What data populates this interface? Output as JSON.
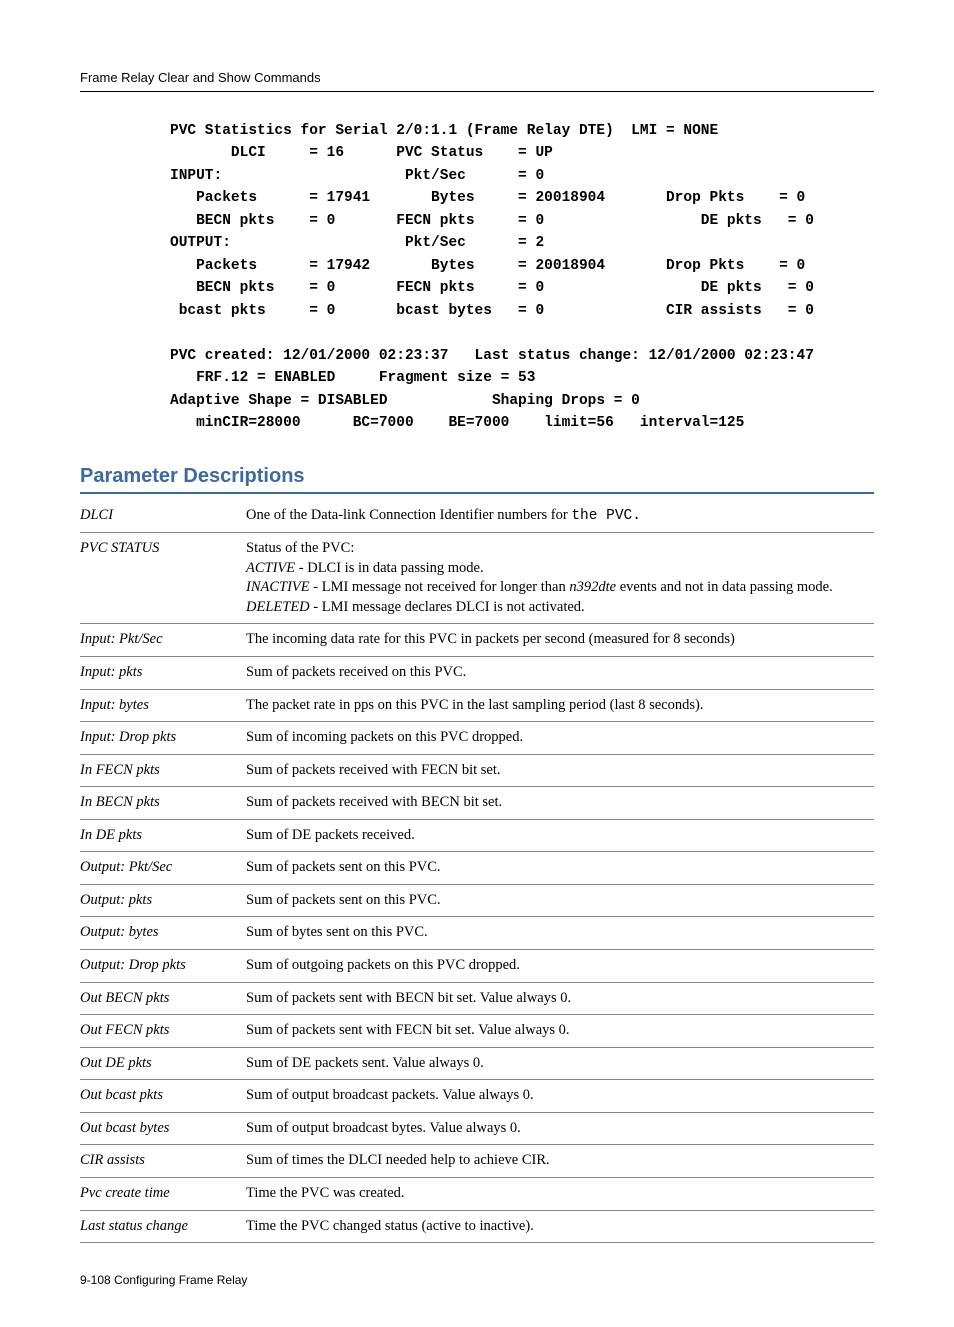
{
  "running_head": "Frame Relay Clear and Show Commands",
  "code": {
    "l1": "PVC Statistics for Serial 2/0:1.1 (Frame Relay DTE)  LMI = NONE",
    "l2": "       DLCI     = 16      PVC Status    = UP",
    "l3": "INPUT:                     Pkt/Sec      = 0",
    "l4": "   Packets      = 17941       Bytes     = 20018904       Drop Pkts    = 0",
    "l5": "   BECN pkts    = 0       FECN pkts     = 0                  DE pkts   = 0",
    "l6": "OUTPUT:                    Pkt/Sec      = 2",
    "l7": "   Packets      = 17942       Bytes     = 20018904       Drop Pkts    = 0",
    "l8": "   BECN pkts    = 0       FECN pkts     = 0                  DE pkts   = 0",
    "l9": " bcast pkts     = 0       bcast bytes   = 0              CIR assists   = 0",
    "l10": "",
    "l11": "PVC created: 12/01/2000 02:23:37   Last status change: 12/01/2000 02:23:47",
    "l12": "   FRF.12 = ENABLED     Fragment size = 53",
    "l13": "Adaptive Shape = DISABLED            Shaping Drops = 0",
    "l14": "   minCIR=28000      BC=7000    BE=7000    limit=56   interval=125"
  },
  "section_title": "Parameter Descriptions",
  "params": [
    {
      "name": "DLCI",
      "desc_pre": "One of the Data-link Connection Identifier numbers for ",
      "desc_code": "the PVC.",
      "desc_post": ""
    },
    {
      "name": "PVC STATUS",
      "lines": [
        "Status of the PVC:",
        "<span class='ital'>ACTIVE</span> - DLCI is in data passing mode.",
        "<span class='ital'>INACTIVE</span> - LMI message not received for longer than <span class='ital'>n392dte</span> events and not in data passing mode.",
        "<span class='ital'>DELETED</span> - LMI message declares DLCI is not activated."
      ]
    },
    {
      "name": "Input: Pkt/Sec",
      "desc": "The incoming data rate for this PVC in packets per second (measured for 8 seconds)"
    },
    {
      "name": "Input: pkts",
      "desc": "Sum of packets received on this PVC."
    },
    {
      "name": "Input: bytes",
      "desc": "The packet rate in pps on this PVC in the last sampling period (last 8 seconds)."
    },
    {
      "name": "Input: Drop pkts",
      "desc": "Sum of incoming packets on this PVC dropped."
    },
    {
      "name": "In FECN pkts",
      "desc": "Sum of packets received with FECN bit set."
    },
    {
      "name": "In BECN pkts",
      "desc": "Sum of packets received with BECN bit set."
    },
    {
      "name": "In DE pkts",
      "desc": "Sum of DE packets received."
    },
    {
      "name": "Output: Pkt/Sec",
      "desc": "Sum of packets sent on this PVC."
    },
    {
      "name": "Output: pkts",
      "desc": "Sum of packets sent on this PVC."
    },
    {
      "name": "Output: bytes",
      "desc": "Sum of bytes sent on this PVC."
    },
    {
      "name": "Output: Drop pkts",
      "desc": "Sum of outgoing packets on this PVC dropped."
    },
    {
      "name": "Out BECN pkts",
      "desc": "Sum of packets sent with BECN bit set. Value always 0."
    },
    {
      "name": "Out FECN pkts",
      "desc": "Sum of packets sent with FECN bit set. Value always 0."
    },
    {
      "name": "Out DE pkts",
      "desc": "Sum of DE packets sent. Value always 0."
    },
    {
      "name": "Out bcast pkts",
      "desc": "Sum of output broadcast packets. Value always 0."
    },
    {
      "name": "Out bcast bytes",
      "desc": "Sum of output broadcast bytes. Value always 0."
    },
    {
      "name": "CIR assists",
      "desc": "Sum of times the DLCI needed help to achieve CIR."
    },
    {
      "name": "Pvc create time",
      "desc": "Time the PVC was created."
    },
    {
      "name": "Last status change",
      "desc": "Time the PVC changed status (active to inactive)."
    }
  ],
  "footer": "9-108   Configuring Frame Relay"
}
